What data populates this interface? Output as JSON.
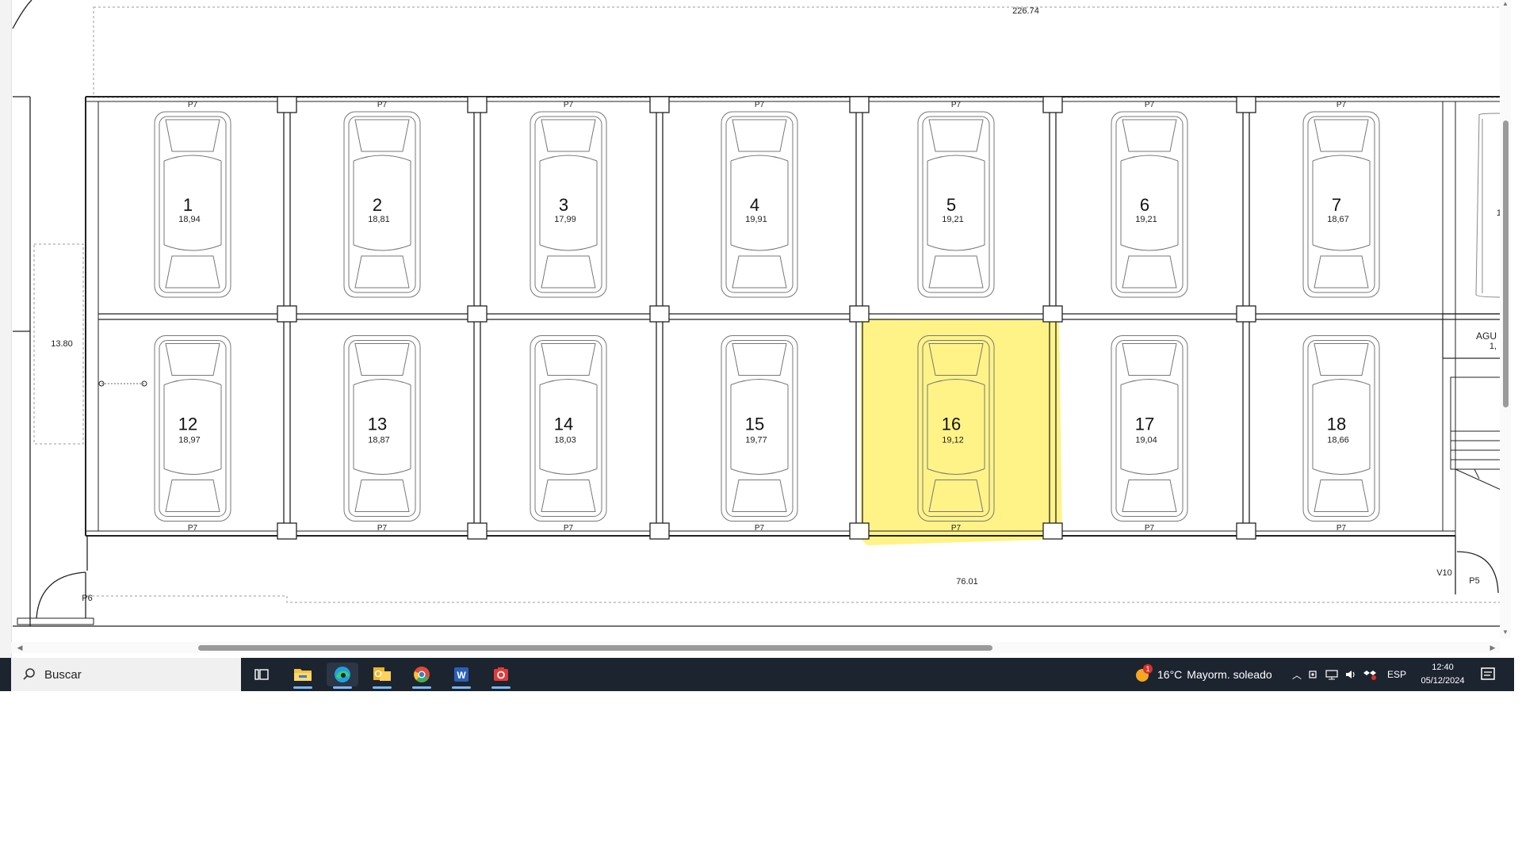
{
  "plan": {
    "top_dimension": "226.74",
    "left_dimension": "13.80",
    "bottom_dimension": "76.01",
    "door_label_left": "P6",
    "door_label_right": "P5",
    "window_label": "V10",
    "room_label": "AGU",
    "room_value": "1,",
    "edge_value": "1",
    "door_code": "P7",
    "highlight_color": "#fff27a",
    "top_row": [
      {
        "number": "1",
        "area": "18,94"
      },
      {
        "number": "2",
        "area": "18,81"
      },
      {
        "number": "3",
        "area": "17,99"
      },
      {
        "number": "4",
        "area": "19,91"
      },
      {
        "number": "5",
        "area": "19,21"
      },
      {
        "number": "6",
        "area": "19,21"
      },
      {
        "number": "7",
        "area": "18,67"
      }
    ],
    "bottom_row": [
      {
        "number": "12",
        "area": "18,97"
      },
      {
        "number": "13",
        "area": "18,87"
      },
      {
        "number": "14",
        "area": "18,03"
      },
      {
        "number": "15",
        "area": "19,77"
      },
      {
        "number": "16",
        "area": "19,12",
        "highlighted": true
      },
      {
        "number": "17",
        "area": "19,04"
      },
      {
        "number": "18",
        "area": "18,66"
      }
    ]
  },
  "taskbar": {
    "search_placeholder": "Buscar",
    "weather_temp": "16°C",
    "weather_text": "Mayorm. soleado",
    "weather_badge": "1",
    "language": "ESP",
    "time": "12:40",
    "date": "05/12/2024",
    "apps": [
      {
        "name": "task-view-icon"
      },
      {
        "name": "file-explorer-icon",
        "color": "#f5c242"
      },
      {
        "name": "edge-icon",
        "color": "#1fa0e0"
      },
      {
        "name": "outlook-icon",
        "color": "#f0b429"
      },
      {
        "name": "chrome-icon",
        "color": "#e04b3a"
      },
      {
        "name": "word-icon",
        "color": "#2b5fb8"
      },
      {
        "name": "snipping-tool-icon",
        "color": "#e23b3b"
      }
    ]
  }
}
